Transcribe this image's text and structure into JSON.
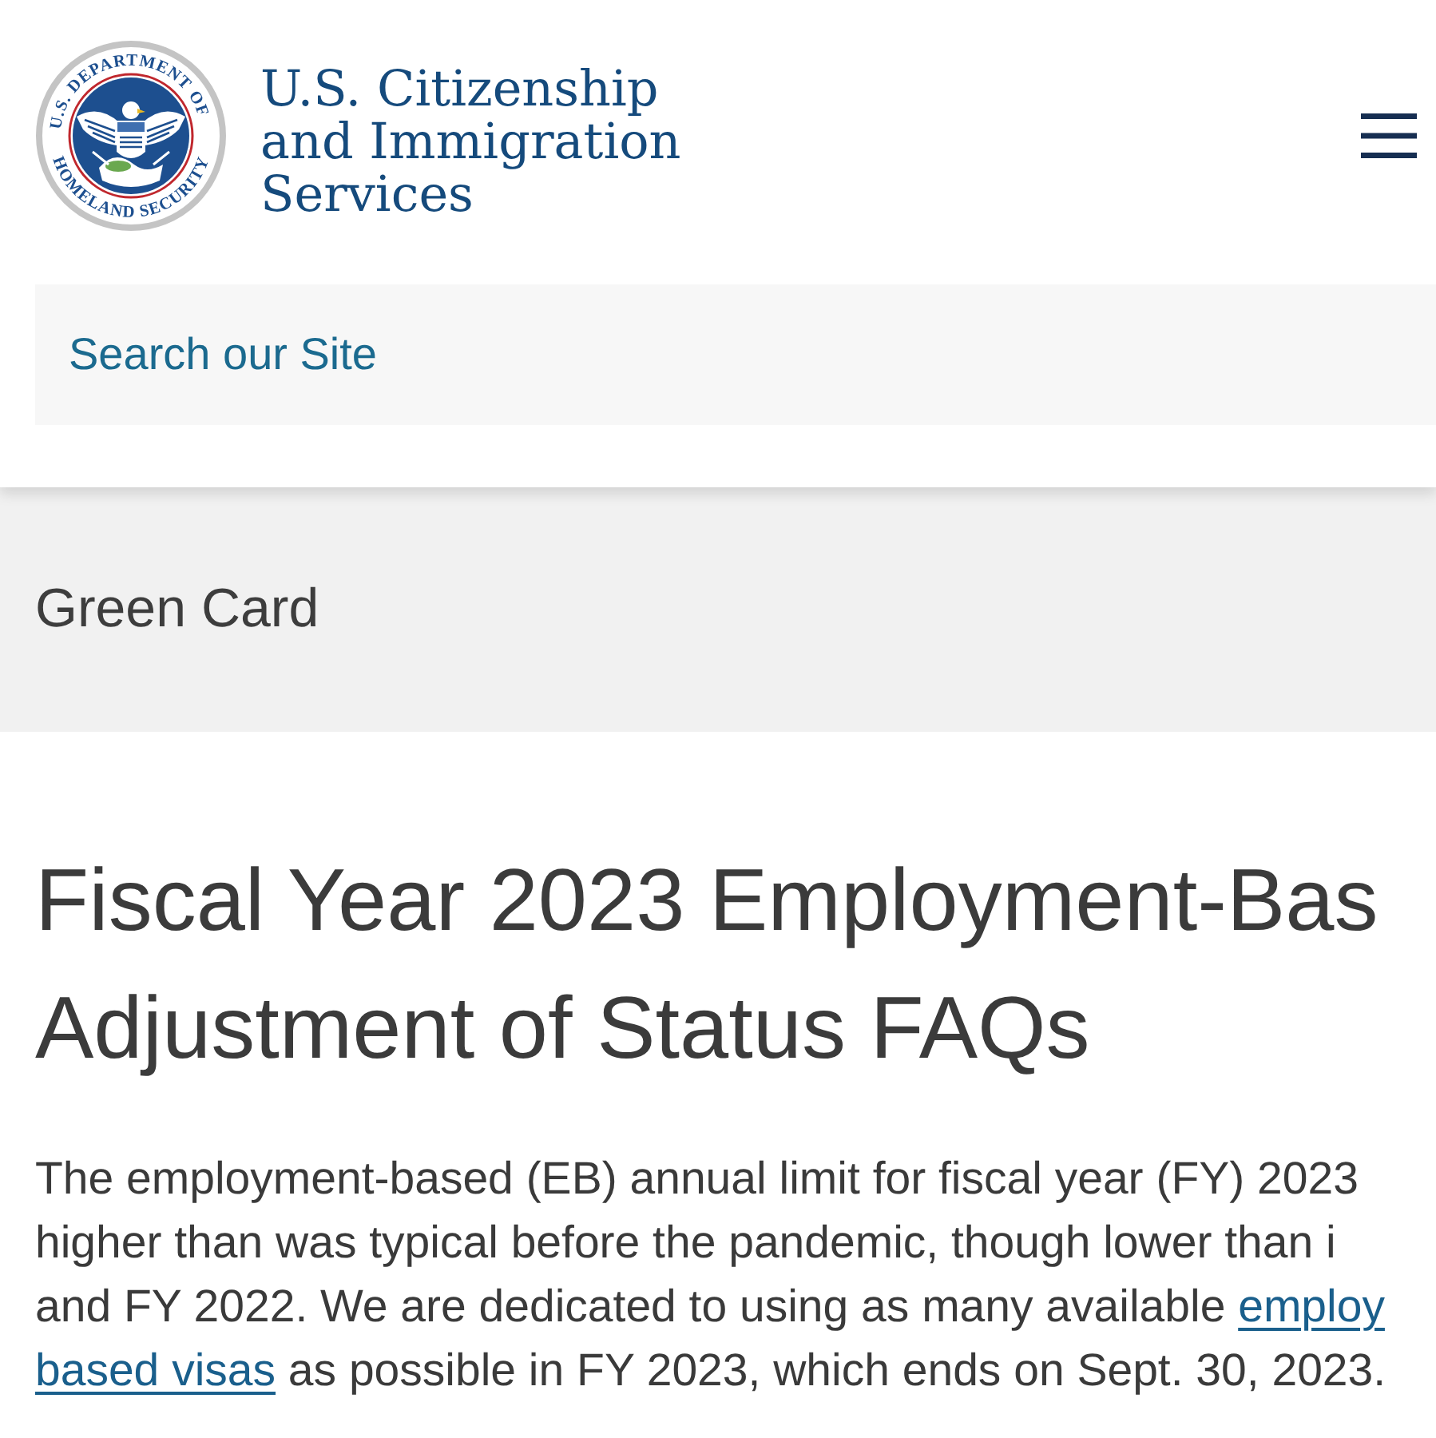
{
  "header": {
    "seal": {
      "text_top": "U.S. DEPARTMENT OF",
      "text_bottom": "HOMELAND SECURITY"
    },
    "agency_name": [
      "U.S. Citizenship",
      "and Immigration",
      "Services"
    ]
  },
  "search": {
    "placeholder": "Search our Site"
  },
  "section_banner": {
    "title": "Green Card"
  },
  "article": {
    "heading_lines": [
      "Fiscal Year 2023 Employment-Bas",
      "Adjustment of Status FAQs"
    ],
    "intro_lines": [
      [
        {
          "kind": "text",
          "text": "The employment-based (EB) annual limit for fiscal year (FY) 2023"
        }
      ],
      [
        {
          "kind": "text",
          "text": "higher than was typical before the pandemic, though lower than i"
        }
      ],
      [
        {
          "kind": "text",
          "text": "and FY 2022. We are dedicated to using as many available "
        },
        {
          "kind": "link",
          "text": "employ"
        }
      ],
      [
        {
          "kind": "link",
          "text": "based visas"
        },
        {
          "kind": "text",
          "text": " as possible in FY 2023, which ends on Sept. 30, 2023."
        }
      ]
    ]
  }
}
